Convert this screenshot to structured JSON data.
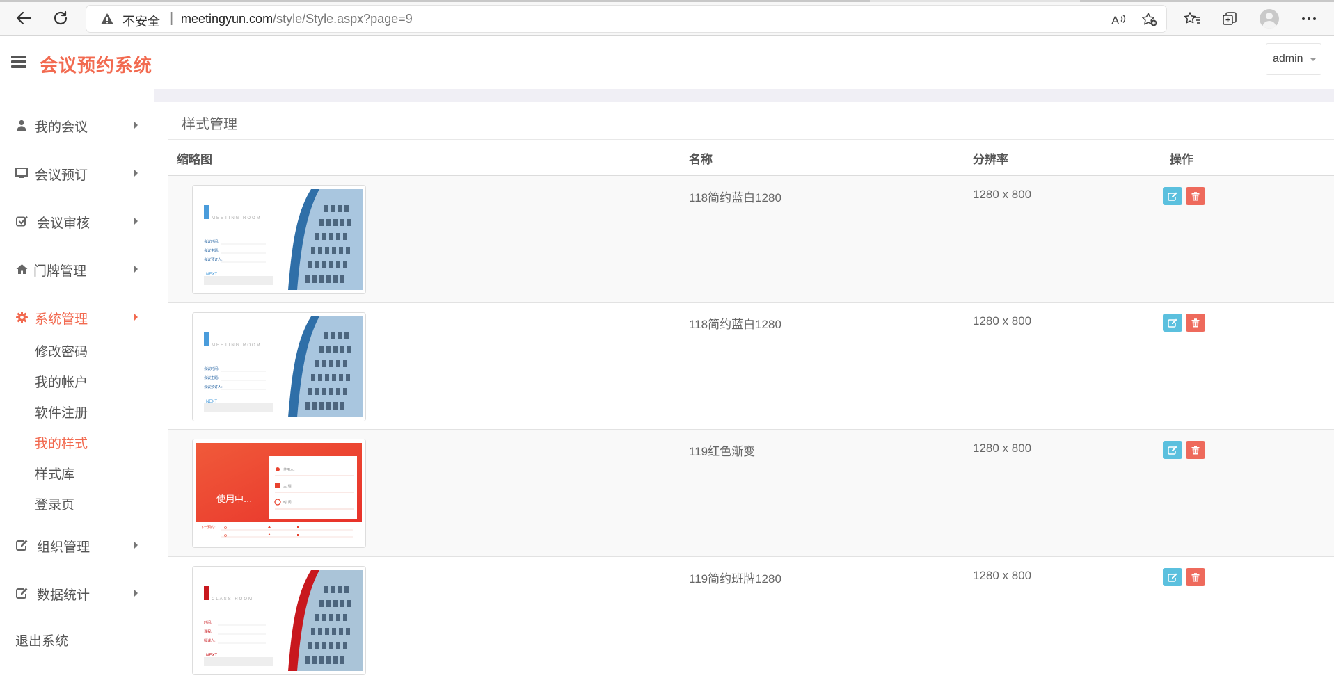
{
  "browser": {
    "insecure_label": "不安全",
    "separator": "|",
    "url_host": "meetingyun.com",
    "url_path": "/style/Style.aspx?page=9"
  },
  "app": {
    "title": "会议预约系统",
    "user": "admin"
  },
  "sidebar": {
    "items": [
      {
        "label": "我的会议",
        "icon": "user-icon"
      },
      {
        "label": "会议预订",
        "icon": "monitor-icon"
      },
      {
        "label": "会议审核",
        "icon": "check-square-icon"
      },
      {
        "label": "门牌管理",
        "icon": "home-icon"
      },
      {
        "label": "系统管理",
        "icon": "gear-icon",
        "active": true
      },
      {
        "label": "组织管理",
        "icon": "edit-icon"
      },
      {
        "label": "数据统计",
        "icon": "edit-icon"
      }
    ],
    "sub_items": [
      {
        "label": "修改密码"
      },
      {
        "label": "我的帐户"
      },
      {
        "label": "软件注册"
      },
      {
        "label": "我的样式",
        "active": true
      },
      {
        "label": "样式库"
      },
      {
        "label": "登录页"
      }
    ],
    "logout": "退出系统"
  },
  "panel": {
    "title": "样式管理",
    "columns": [
      "缩略图",
      "名称",
      "分辨率",
      "操作"
    ],
    "rows": [
      {
        "name": "118简约蓝白1280",
        "resolution": "1280 x 800",
        "thumb": {
          "room": "MEETING ROOM",
          "field1": "会议时间:",
          "field2": "会议主题:",
          "field3": "会议预订人:",
          "next": "NEXT"
        }
      },
      {
        "name": "118简约蓝白1280",
        "resolution": "1280 x 800",
        "thumb": {
          "room": "MEETING ROOM",
          "field1": "会议时间:",
          "field2": "会议主题:",
          "field3": "会议预订人:",
          "next": "NEXT"
        }
      },
      {
        "name": "119红色渐变",
        "resolution": "1280 x 800",
        "thumb": {
          "status": "使用中...",
          "field1": "使用人:",
          "field2": "主 题:",
          "field3": "时 间:",
          "next": "下一预约:"
        }
      },
      {
        "name": "119简约班牌1280",
        "resolution": "1280 x 800",
        "thumb": {
          "room": "CLASS ROOM",
          "field1": "时间:",
          "field2": "课程:",
          "field3": "授课人:",
          "next": "NEXT"
        }
      }
    ]
  },
  "colors": {
    "brand": "#f26a50",
    "edit_button": "#5bc0de",
    "delete_button": "#ee6a5c"
  }
}
